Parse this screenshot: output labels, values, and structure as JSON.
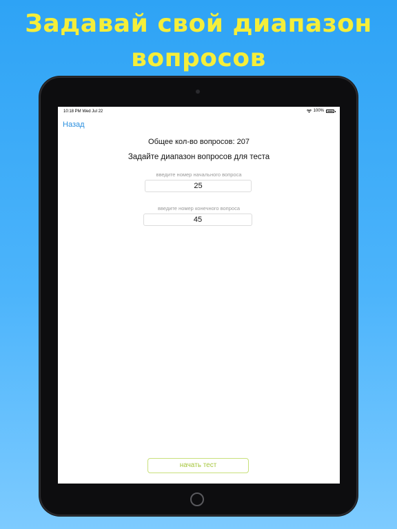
{
  "promo": {
    "line1": "Задавай свой диапазон",
    "line2": "вопросов",
    "color": "#f5ee3a"
  },
  "status_bar": {
    "time": "10:18 PM  Wed Jul 22",
    "battery": "100%",
    "icons": [
      "wifi-icon",
      "battery-icon"
    ]
  },
  "nav": {
    "back_label": "Назад"
  },
  "main": {
    "total_label": "Общее кол-во вопросов: 207",
    "prompt": "Задайте диапазон вопросов для теста",
    "start_hint": "введите номер начального вопроса",
    "start_value": "25",
    "end_hint": "введите номер конечного вопроса",
    "end_value": "45",
    "start_button_label": "начать тест"
  },
  "colors": {
    "accent_link": "#2a8fdf",
    "button_text": "#a6c63d",
    "background_blue": "#3aaaf8"
  }
}
